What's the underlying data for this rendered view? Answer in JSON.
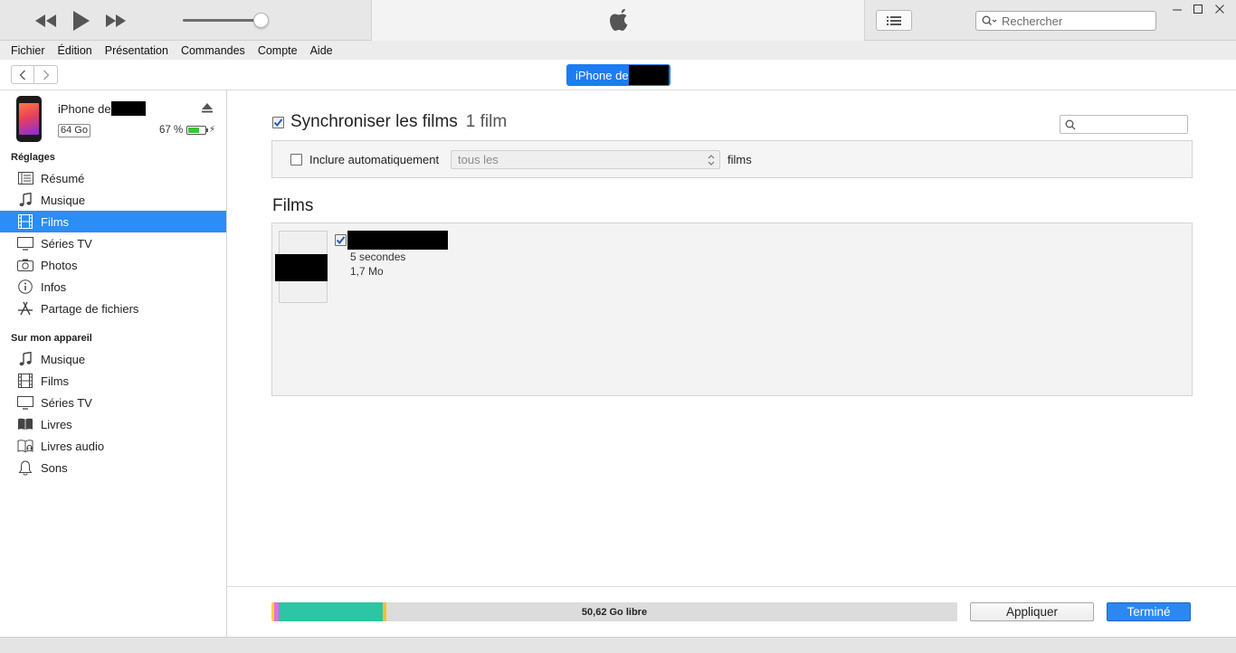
{
  "window": {
    "search_placeholder": "Rechercher",
    "controls": [
      "minimize-icon",
      "maximize-icon",
      "close-icon"
    ]
  },
  "menu": [
    "Fichier",
    "Édition",
    "Présentation",
    "Commandes",
    "Compte",
    "Aide"
  ],
  "nav": {
    "device_button_label": "iPhone de"
  },
  "volume": 0.92,
  "sidebar": {
    "device": {
      "name": "iPhone de",
      "capacity": "64 Go",
      "battery_percent": "67 %",
      "battery_level": 0.67
    },
    "settings_title": "Réglages",
    "settings_items": [
      {
        "label": "Résumé",
        "icon": "summary-icon"
      },
      {
        "label": "Musique",
        "icon": "music-note-icon"
      },
      {
        "label": "Films",
        "icon": "film-icon",
        "active": true
      },
      {
        "label": "Séries TV",
        "icon": "tv-icon"
      },
      {
        "label": "Photos",
        "icon": "camera-icon"
      },
      {
        "label": "Infos",
        "icon": "info-icon"
      },
      {
        "label": "Partage de fichiers",
        "icon": "app-store-icon"
      }
    ],
    "device_title": "Sur mon appareil",
    "device_items": [
      {
        "label": "Musique",
        "icon": "music-note-icon"
      },
      {
        "label": "Films",
        "icon": "film-icon"
      },
      {
        "label": "Séries TV",
        "icon": "tv-icon"
      },
      {
        "label": "Livres",
        "icon": "book-icon"
      },
      {
        "label": "Livres audio",
        "icon": "audiobook-icon"
      },
      {
        "label": "Sons",
        "icon": "bell-icon"
      }
    ]
  },
  "main": {
    "sync_label": "Synchroniser les films",
    "sync_count": "1 film",
    "sync_checked": true,
    "auto_include_label": "Inclure automatiquement",
    "auto_include_checked": false,
    "auto_select_value": "tous les",
    "auto_suffix": "films",
    "films_heading": "Films",
    "films": [
      {
        "duration": "5 secondes",
        "size": "1,7 Mo",
        "checked": true
      }
    ]
  },
  "footer": {
    "free_space": "50,62 Go libre",
    "apply_label": "Appliquer",
    "done_label": "Terminé",
    "capacity_segments": [
      {
        "color": "#f5d33a",
        "fraction": 0.004
      },
      {
        "color": "#e46de0",
        "fraction": 0.006
      },
      {
        "color": "#2dc5a3",
        "fraction": 0.152
      },
      {
        "color": "#f2c230",
        "fraction": 0.005
      }
    ]
  },
  "colors": {
    "accent": "#2b8df5",
    "done_button": "#2c87f0"
  }
}
